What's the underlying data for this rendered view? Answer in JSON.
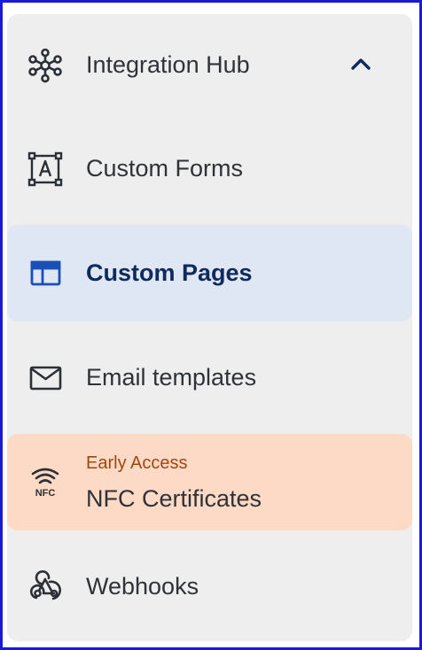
{
  "menu": {
    "integration_hub": {
      "label": "Integration Hub",
      "icon": "hub-network-icon",
      "expanded": true
    },
    "custom_forms": {
      "label": "Custom Forms",
      "icon": "form-text-icon"
    },
    "custom_pages": {
      "label": "Custom Pages",
      "icon": "web-page-icon",
      "active": true
    },
    "email_templates": {
      "label": "Email templates",
      "icon": "mail-envelope-icon"
    },
    "nfc_certificates": {
      "label": "NFC Certificates",
      "badge": "Early Access",
      "icon": "nfc-icon",
      "icon_text": "NFC"
    },
    "webhooks": {
      "label": "Webhooks",
      "icon": "webhook-icon"
    }
  },
  "colors": {
    "active_bg": "#dfe6f4",
    "active_text": "#0f2a5c",
    "early_access_bg": "#fcdac6",
    "early_access_text": "#a2460f"
  }
}
